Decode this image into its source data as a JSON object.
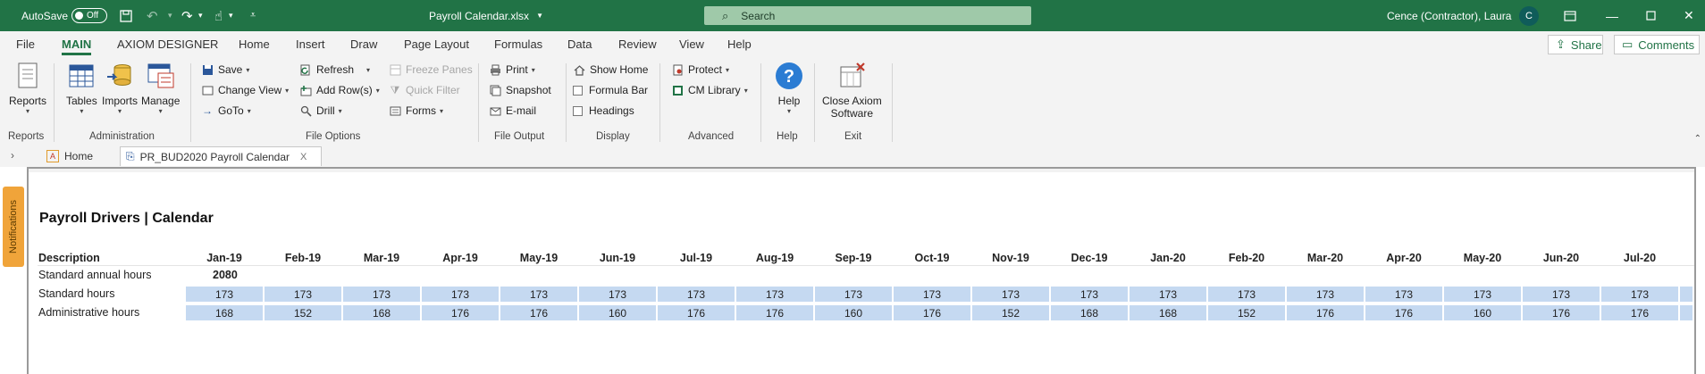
{
  "titlebar": {
    "autosave_label": "AutoSave",
    "autosave_state": "Off",
    "document_title": "Payroll Calendar.xlsx",
    "search_placeholder": "Search",
    "user_name": "Cence (Contractor), Laura",
    "avatar_initial": "C"
  },
  "ribbon": {
    "tabs": [
      "File",
      "MAIN",
      "AXIOM DESIGNER",
      "Home",
      "Insert",
      "Draw",
      "Page Layout",
      "Formulas",
      "Data",
      "Review",
      "View",
      "Help"
    ],
    "share_label": "Share",
    "comments_label": "Comments",
    "reports_btn": "Reports",
    "tables_btn": "Tables",
    "imports_btn": "Imports",
    "manage_btn": "Manage",
    "save": "Save",
    "change_view": "Change View",
    "goto": "GoTo",
    "refresh": "Refresh",
    "add_rows": "Add Row(s)",
    "drill": "Drill",
    "freeze_panes": "Freeze Panes",
    "quick_filter": "Quick Filter",
    "forms": "Forms",
    "print": "Print",
    "snapshot": "Snapshot",
    "email": "E-mail",
    "show_home": "Show Home",
    "formula_bar": "Formula Bar",
    "headings": "Headings",
    "protect": "Protect",
    "cm_library": "CM Library",
    "help_btn": "Help",
    "close_axiom_line1": "Close Axiom",
    "close_axiom_line2": "Software",
    "groups": {
      "reports": "Reports",
      "administration": "Administration",
      "file_options": "File Options",
      "file_output": "File Output",
      "display": "Display",
      "advanced": "Advanced",
      "help": "Help",
      "exit": "Exit"
    }
  },
  "tabstrip": {
    "home_tab": "Home",
    "file_tab": "PR_BUD2020 Payroll Calendar",
    "close_glyph": "X"
  },
  "notifications_label": "Notifications",
  "sheet": {
    "title": "Payroll Drivers | Calendar",
    "description_header": "Description",
    "months": [
      "Jan-19",
      "Feb-19",
      "Mar-19",
      "Apr-19",
      "May-19",
      "Jun-19",
      "Jul-19",
      "Aug-19",
      "Sep-19",
      "Oct-19",
      "Nov-19",
      "Dec-19",
      "Jan-20",
      "Feb-20",
      "Mar-20",
      "Apr-20",
      "May-20",
      "Jun-20",
      "Jul-20"
    ],
    "rows": {
      "standard_annual": {
        "label": "Standard annual hours",
        "value": "2080"
      },
      "standard_hours": {
        "label": "Standard hours",
        "values": [
          "173",
          "173",
          "173",
          "173",
          "173",
          "173",
          "173",
          "173",
          "173",
          "173",
          "173",
          "173",
          "173",
          "173",
          "173",
          "173",
          "173",
          "173",
          "173"
        ]
      },
      "administrative_hours": {
        "label": "Administrative hours",
        "values": [
          "168",
          "152",
          "168",
          "176",
          "176",
          "160",
          "176",
          "176",
          "160",
          "176",
          "152",
          "168",
          "168",
          "152",
          "176",
          "176",
          "160",
          "176",
          "176"
        ]
      }
    }
  },
  "colors": {
    "excel_green": "#217346",
    "cell_fill": "#c5d9f1",
    "notification_tab": "#f0a43a"
  }
}
